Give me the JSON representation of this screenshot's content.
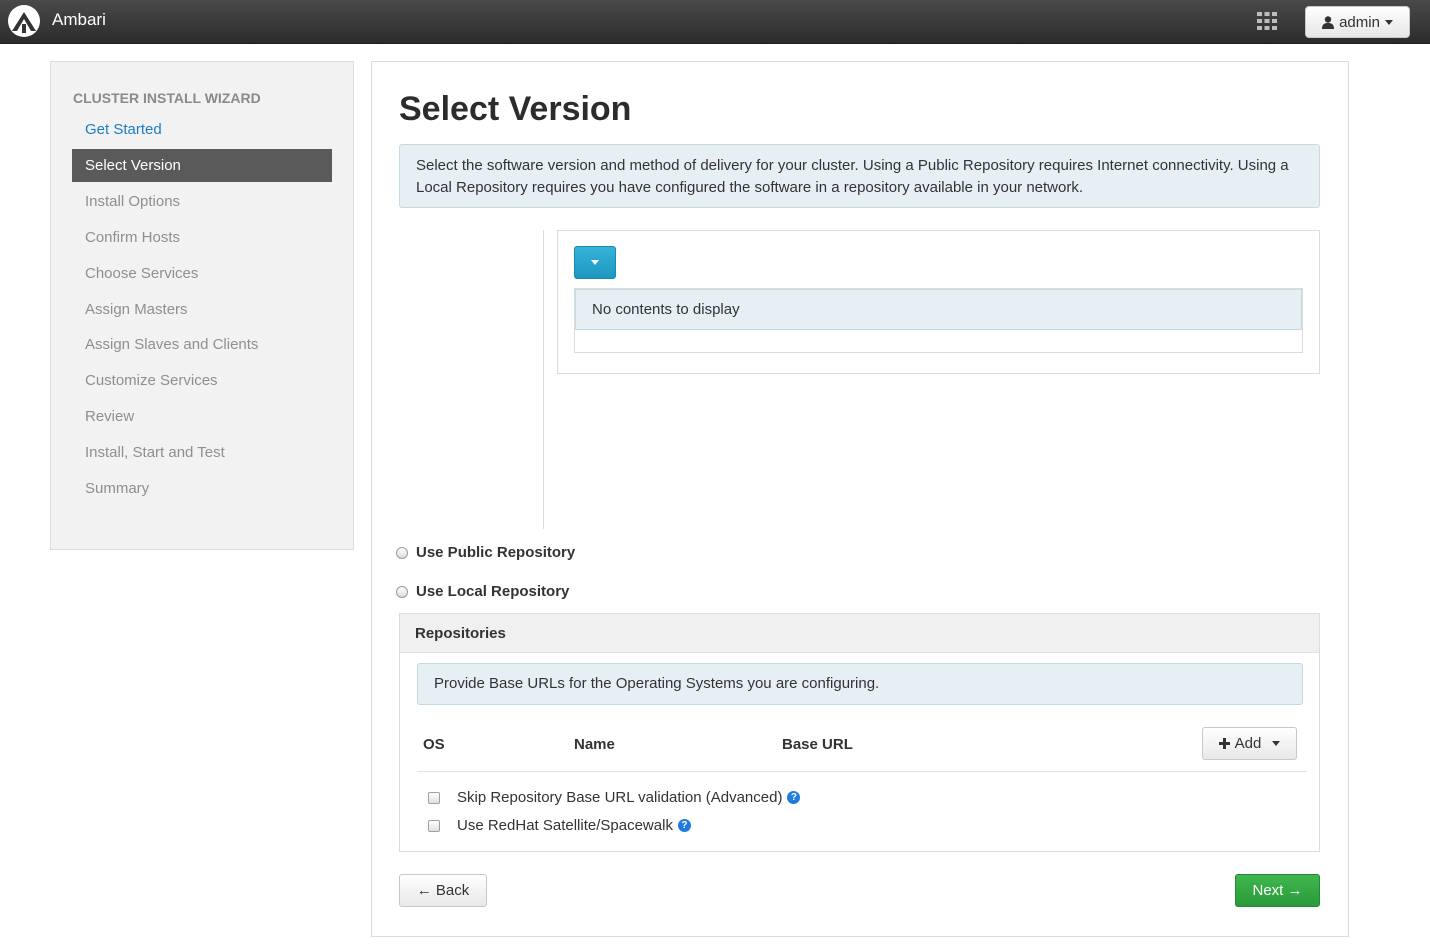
{
  "navbar": {
    "brand": "Ambari",
    "user_label": "admin",
    "icons": {
      "logo": "ambari-logo",
      "apps": "grid-icon",
      "user": "user-icon"
    }
  },
  "sidebar": {
    "header": "CLUSTER INSTALL WIZARD",
    "items": [
      {
        "label": "Get Started",
        "state": "link"
      },
      {
        "label": "Select Version",
        "state": "active"
      },
      {
        "label": "Install Options",
        "state": "disabled"
      },
      {
        "label": "Confirm Hosts",
        "state": "disabled"
      },
      {
        "label": "Choose Services",
        "state": "disabled"
      },
      {
        "label": "Assign Masters",
        "state": "disabled"
      },
      {
        "label": "Assign Slaves and Clients",
        "state": "disabled"
      },
      {
        "label": "Customize Services",
        "state": "disabled"
      },
      {
        "label": "Review",
        "state": "disabled"
      },
      {
        "label": "Install, Start and Test",
        "state": "disabled"
      },
      {
        "label": "Summary",
        "state": "disabled"
      }
    ]
  },
  "main": {
    "title": "Select Version",
    "intro": "Select the software version and method of delivery for your cluster. Using a Public Repository requires Internet connectivity. Using a Local Repository requires you have configured the software in a repository available in your network.",
    "version_empty_text": "No contents to display",
    "options": {
      "public_repo": "Use Public Repository",
      "local_repo": "Use Local Repository"
    },
    "repositories": {
      "title": "Repositories",
      "info": "Provide Base URLs for the Operating Systems you are configuring.",
      "columns": {
        "os": "OS",
        "name": "Name",
        "base_url": "Base URL"
      },
      "add_label": "Add",
      "skip_validation_label": "Skip Repository Base URL validation (Advanced)",
      "satellite_label": "Use RedHat Satellite/Spacewalk"
    },
    "buttons": {
      "back": "← Back",
      "next": "Next →"
    }
  },
  "colors": {
    "navbar_bg": "#333333",
    "active_item": "#5a5a5a",
    "link": "#1a7ec1",
    "info_bg": "#e6eff4",
    "primary_blue": "#1d97c0",
    "success_green": "#2a9a3a",
    "help_icon": "#1f7be0"
  }
}
